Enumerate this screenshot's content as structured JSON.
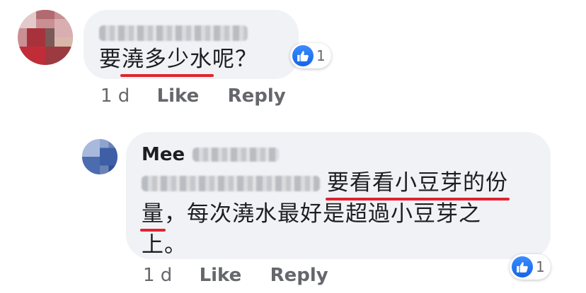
{
  "comment1": {
    "text_before": "要",
    "text_underlined": "澆多少水",
    "text_after": "呢？",
    "meta": {
      "time": "1 d",
      "like_label": "Like",
      "reply_label": "Reply"
    },
    "reactions": {
      "icon": "thumbs-up-icon",
      "count": "1"
    }
  },
  "reply1": {
    "author_visible": "Mee",
    "line1_underlined": "要看看小豆芽的份",
    "line2_underlined": "量",
    "line2_rest": "，每次澆水最好是超過小豆芽之",
    "line3": "上。",
    "meta": {
      "time": "1 d",
      "like_label": "Like",
      "reply_label": "Reply"
    },
    "reactions": {
      "icon": "thumbs-up-icon",
      "count": "1"
    }
  },
  "colors": {
    "bubble": "#f0f2f5",
    "underline": "#e0232e",
    "like_blue": "#1877f2",
    "meta_gray": "#65676b"
  }
}
